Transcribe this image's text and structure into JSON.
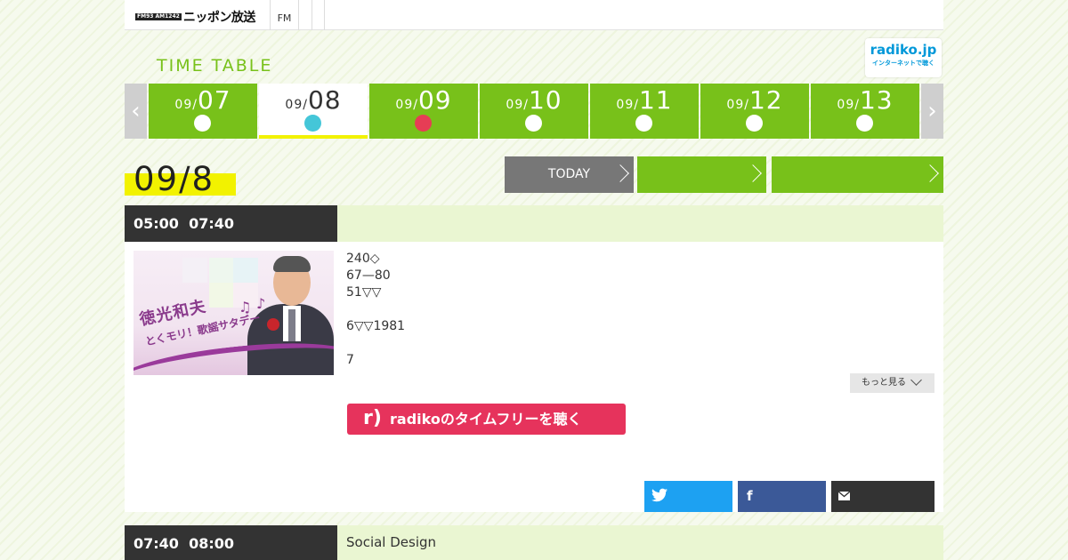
{
  "header": {
    "logo_mini": "FM93 AM1242",
    "logo_text": "ニッポン放送",
    "nav": [
      "FM",
      "",
      ""
    ]
  },
  "radiko_badge": {
    "main": "radiko.jp",
    "sub": "インターネットで聴く"
  },
  "timetable_title": "TIME TABLE",
  "date_tabs": [
    {
      "month": "09/",
      "day": "07",
      "state": "normal"
    },
    {
      "month": "09/",
      "day": "08",
      "state": "active"
    },
    {
      "month": "09/",
      "day": "09",
      "state": "saturday"
    },
    {
      "month": "09/",
      "day": "10",
      "state": "normal"
    },
    {
      "month": "09/",
      "day": "11",
      "state": "normal"
    },
    {
      "month": "09/",
      "day": "12",
      "state": "normal"
    },
    {
      "month": "09/",
      "day": "13",
      "state": "normal"
    }
  ],
  "nav_arrows": {
    "prev": "‹",
    "next": "›"
  },
  "current_date": "09/8",
  "buttons": {
    "today": "TODAY",
    "next1": "",
    "next2": ""
  },
  "programs": [
    {
      "time": "05:00  07:40",
      "title": "",
      "image_text": {
        "name": "徳光和夫",
        "subtitle": "とくモリ！歌謡サタデー"
      },
      "description": [
        "240◇",
        "67—80",
        "51▽▽",
        "",
        "6▽▽1981",
        "",
        "7"
      ],
      "more_label": "もっと見る",
      "radiko_label": "radikoのタイムフリーを聴く",
      "share": {
        "twitter_icon": "twitter-icon",
        "facebook_icon": "facebook-icon",
        "mail_icon": "mail-icon"
      }
    },
    {
      "time": "07:40  08:00",
      "title": "Social Design"
    }
  ],
  "colors": {
    "green": "#78c11a",
    "highlight": "#f2f200",
    "radiko_pink": "#e6335c",
    "twitter": "#1da1f2",
    "facebook": "#3b5998",
    "dark": "#333333"
  }
}
